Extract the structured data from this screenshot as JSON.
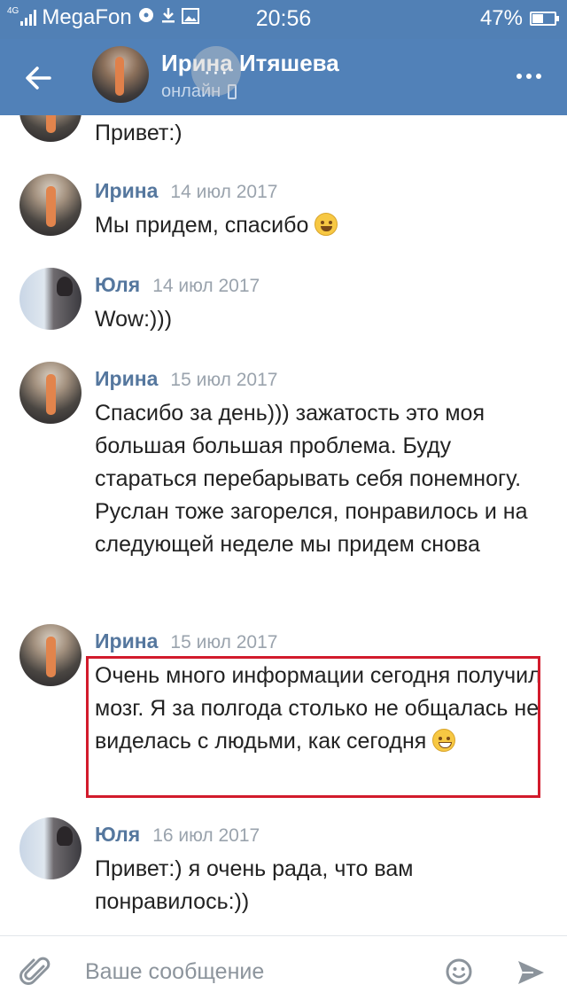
{
  "status_bar": {
    "network_type": "4G",
    "carrier": "MegaFon",
    "time": "20:56",
    "battery": "47%"
  },
  "header": {
    "contact_name": "Ирина Итяшева",
    "status": "онлайн",
    "overlay_dots": "···",
    "accent_color": "#5181b8"
  },
  "messages": [
    {
      "author": "",
      "date": "",
      "text": "Привет:)",
      "avatar": "irina"
    },
    {
      "author": "Ирина",
      "date": "14 июл 2017",
      "text": "Мы придем, спасибо",
      "emoji": "smile",
      "avatar": "irina"
    },
    {
      "author": "Юля",
      "date": "14 июл 2017",
      "text": "Wow:)))",
      "avatar": "yulia"
    },
    {
      "author": "Ирина",
      "date": "15 июл 2017",
      "text": "Спасибо за день))) зажатость это моя большая большая проблема. Буду стараться перебарывать себя понемногу. Руслан тоже загорелся, понравилось и на следующей неделе мы придем снова",
      "avatar": "irina"
    },
    {
      "author": "Ирина",
      "date": "15 июл 2017",
      "text": "Очень много информации сегодня получил мозг. Я за полгода столько не общалась не виделась с людьми, как сегодня",
      "emoji": "grin",
      "avatar": "irina",
      "highlighted": true
    },
    {
      "author": "Юля",
      "date": "16 июл 2017",
      "text": "Привет:) я очень рада, что вам понравилось:))",
      "avatar": "yulia"
    }
  ],
  "input": {
    "placeholder": "Ваше сообщение",
    "value": ""
  },
  "icons": {
    "back": "arrow-left-icon",
    "more": "more-dots-icon",
    "attach": "paperclip-icon",
    "emoji": "smiley-icon",
    "send": "send-arrow-icon"
  }
}
